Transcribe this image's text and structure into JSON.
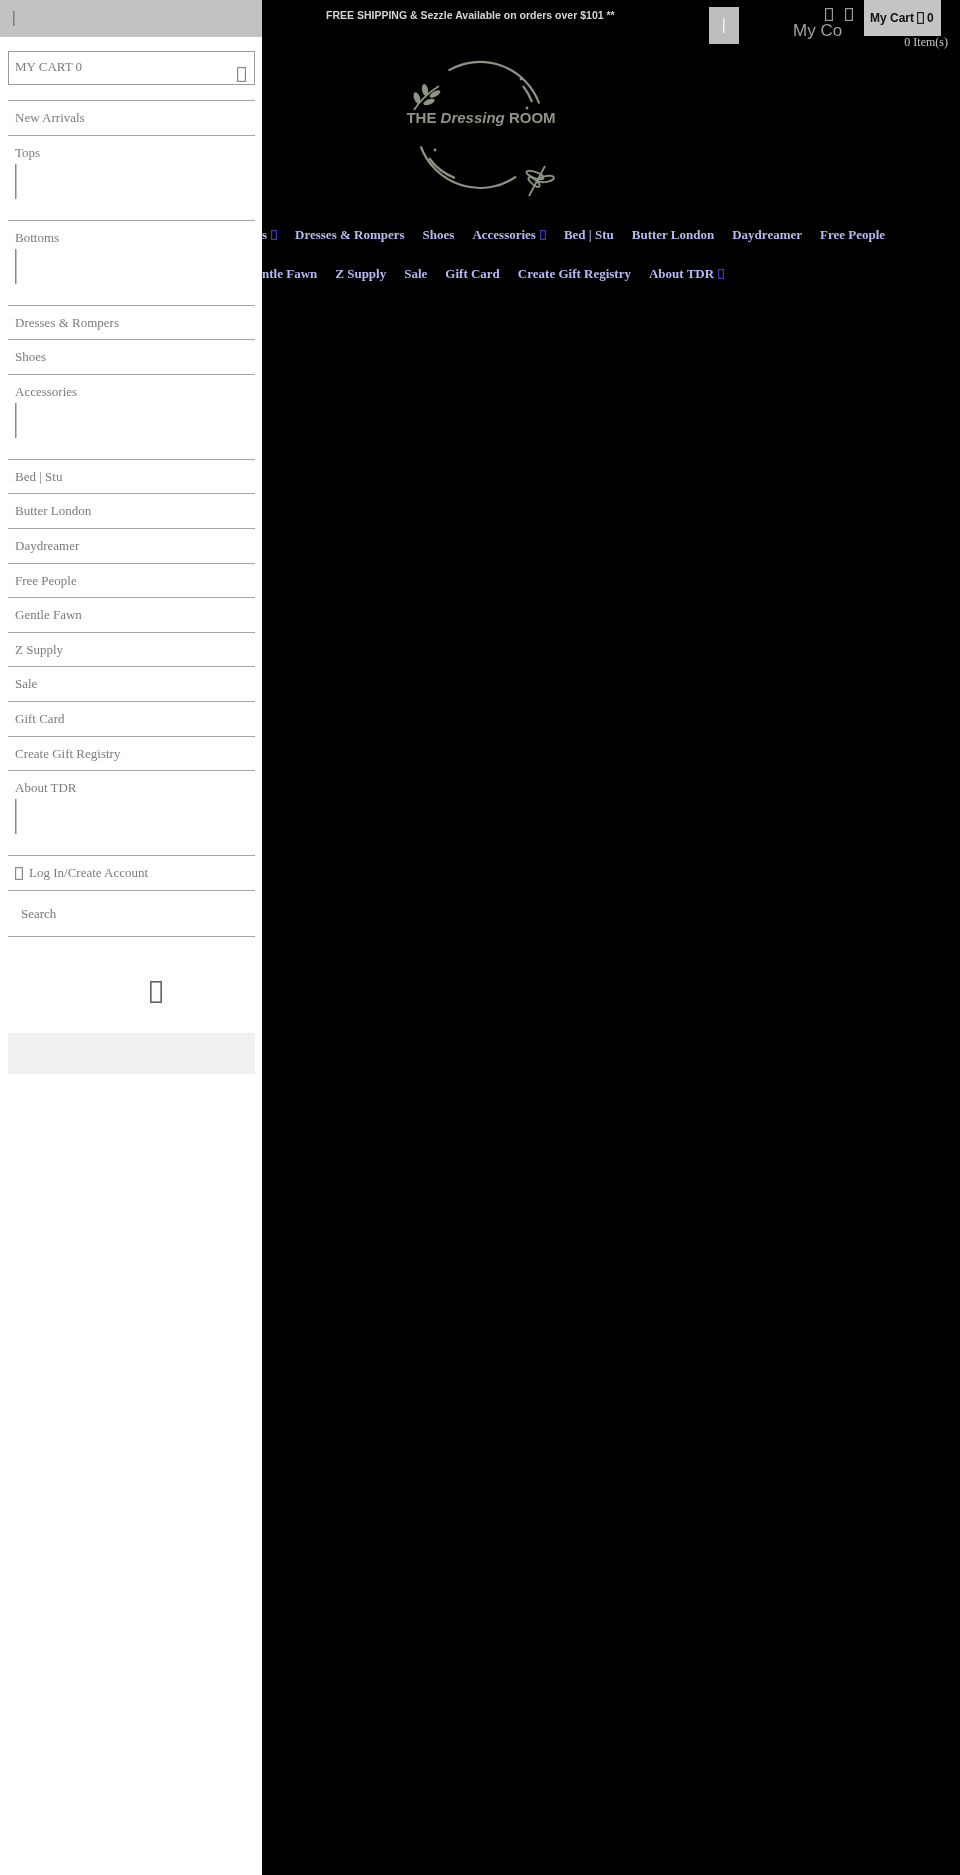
{
  "drawer": {
    "cart_label": "MY CART 0",
    "menu": [
      {
        "label": "New Arrivals",
        "kind": "link"
      },
      {
        "label": "Tops",
        "kind": "submenu"
      },
      {
        "label": "Bottoms",
        "kind": "submenu"
      },
      {
        "label": "Dresses & Rompers",
        "kind": "link"
      },
      {
        "label": "Shoes",
        "kind": "link"
      },
      {
        "label": "Accessories",
        "kind": "submenu"
      },
      {
        "label": "Bed | Stu",
        "kind": "link"
      },
      {
        "label": "Butter London",
        "kind": "link"
      },
      {
        "label": "Daydreamer",
        "kind": "link"
      },
      {
        "label": "Free People",
        "kind": "link"
      },
      {
        "label": "Gentle Fawn",
        "kind": "link"
      },
      {
        "label": "Z Supply",
        "kind": "link"
      },
      {
        "label": "Sale",
        "kind": "link"
      },
      {
        "label": "Gift Card",
        "kind": "link"
      },
      {
        "label": "Create Gift Registry",
        "kind": "link"
      },
      {
        "label": "About TDR",
        "kind": "submenu"
      }
    ],
    "account_link": "Log In/Create Account",
    "search": {
      "placeholder": "Search"
    }
  },
  "announcement": "FREE SHIPPING & Sezzle Available on orders over $101 **",
  "header": {
    "ghost_text": "My Co",
    "cart_button": {
      "label": "My Cart",
      "count": "0"
    },
    "cart_items": "0 Item(s)"
  },
  "logo": {
    "text": "THE *Dressing* ROOM"
  },
  "nav": {
    "rows": [
      [
        {
          "label": "s",
          "dropdown": true
        },
        {
          "label": "Dresses & Rompers",
          "dropdown": false
        },
        {
          "label": "Shoes",
          "dropdown": false
        },
        {
          "label": "Accessories",
          "dropdown": true
        },
        {
          "label": "Bed | Stu",
          "dropdown": false
        },
        {
          "label": "Butter London",
          "dropdown": false
        },
        {
          "label": "Daydreamer",
          "dropdown": false
        },
        {
          "label": "Free People",
          "dropdown": false
        }
      ],
      [
        {
          "label": "ntle Fawn",
          "dropdown": false
        },
        {
          "label": "Z Supply",
          "dropdown": false
        },
        {
          "label": "Sale",
          "dropdown": false
        },
        {
          "label": "Gift Card",
          "dropdown": false
        },
        {
          "label": "Create Gift Registry",
          "dropdown": false
        },
        {
          "label": "About TDR",
          "dropdown": true
        }
      ]
    ]
  }
}
